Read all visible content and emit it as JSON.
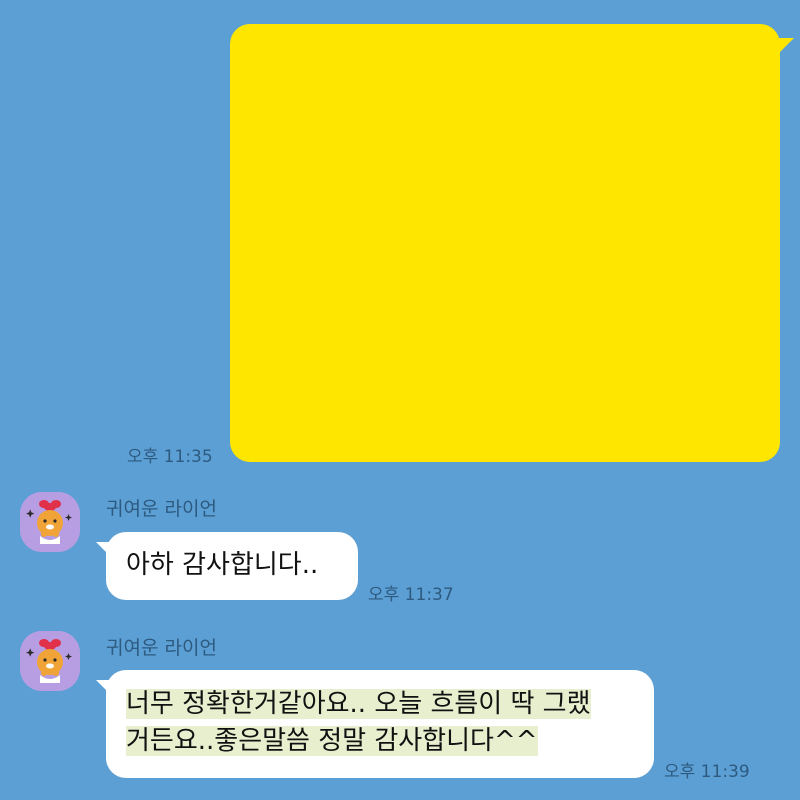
{
  "chat": {
    "outgoing": {
      "time": "오후 11:35",
      "bubble_color": "#ffe600"
    },
    "incoming": [
      {
        "sender": "귀여운 라이언",
        "avatar_icon": "ryan-character-icon",
        "lines": [
          "아하 감사합니다.."
        ],
        "time": "오후 11:37"
      },
      {
        "sender": "귀여운 라이언",
        "avatar_icon": "ryan-character-icon",
        "lines": [
          "너무 정확한거같아요.. 오늘 흐름이 딱 그랬",
          "거든요..좋은말씀 정말 감사합니다^^ "
        ],
        "time": "오후 11:39"
      }
    ],
    "background_color": "#5b9fd4",
    "highlight_color": "#e7efcf"
  }
}
